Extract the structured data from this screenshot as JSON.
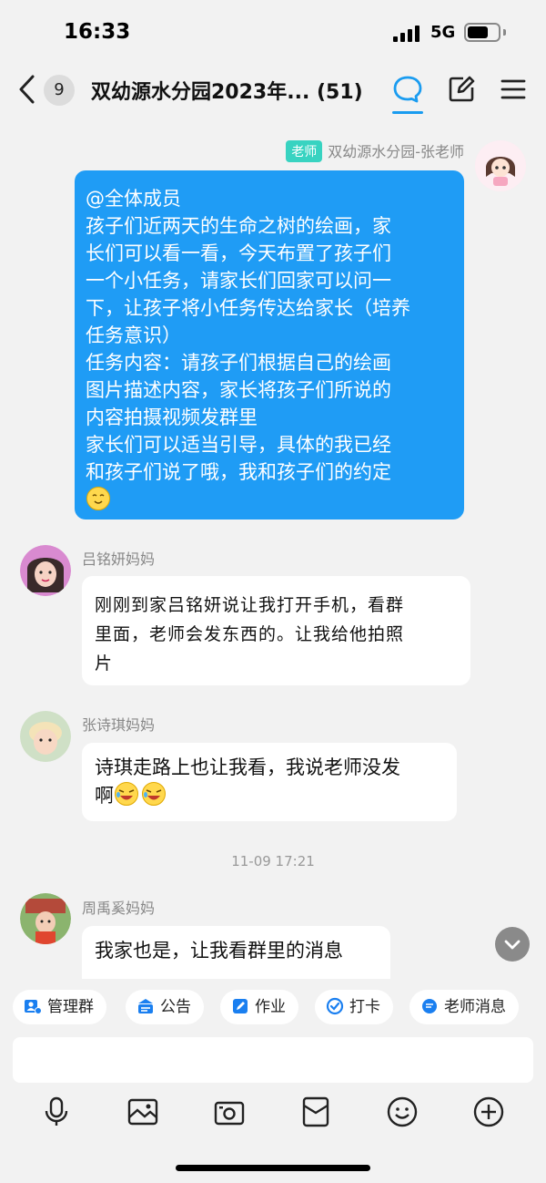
{
  "status_bar": {
    "time": "16:33",
    "network": "5G"
  },
  "nav": {
    "unread_count": "9",
    "title": "双幼源水分园2023年...",
    "member_count": "(51)",
    "accent_color": "#1a9cf0",
    "icons": [
      "back-chevron-icon",
      "chat-bubble-icon",
      "edit-icon",
      "menu-icon"
    ]
  },
  "messages": [
    {
      "role_tag": "老师",
      "sender": "双幼源水分园-张老师",
      "lines": [
        "@全体成员",
        "孩子们近两天的生命之树的绘画，家",
        "长们可以看一看，今天布置了孩子们",
        "一个小任务，请家长们回家可以问一",
        "下，让孩子将小任务传达给家长（培养",
        "任务意识）",
        "任务内容：请孩子们根据自己的绘画",
        "图片描述内容，家长将孩子们所说的",
        "内容拍摄视频发群里",
        "家长们可以适当引导，具体的我已经",
        "和孩子们说了哦，我和孩子们的约定"
      ],
      "emoji": "smile-emoji"
    },
    {
      "sender": "吕铭妍妈妈",
      "lines": [
        "刚刚到家吕铭妍说让我打开手机，看群",
        "里面，老师会发东西的。让我给他拍照",
        "片"
      ]
    },
    {
      "sender": "张诗琪妈妈",
      "lines": [
        "诗琪走路上也让我看，我说老师没发",
        "啊"
      ],
      "emoji": "laugh-emoji"
    },
    {
      "sender": "周禹奚妈妈",
      "lines": [
        "我家也是，让我看群里的消息"
      ]
    }
  ],
  "timestamp": "11-09 17:21",
  "quick_actions": [
    "管理群",
    "公告",
    "作业",
    "打卡",
    "老师消息"
  ],
  "toolbar": [
    "microphone-icon",
    "image-icon",
    "camera-icon",
    "red-packet-icon",
    "emoji-icon",
    "plus-icon"
  ]
}
